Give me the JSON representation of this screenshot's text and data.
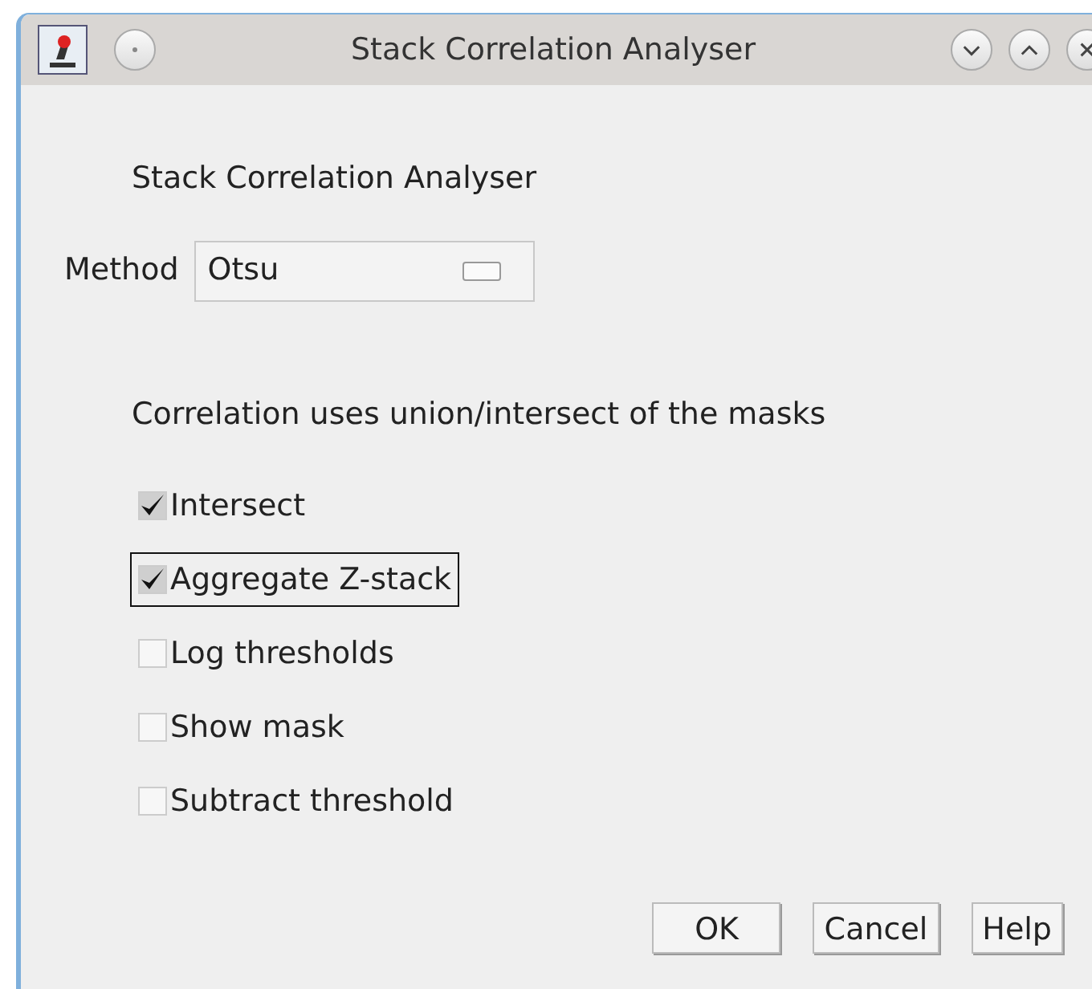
{
  "window": {
    "title": "Stack Correlation Analyser"
  },
  "heading": "Stack Correlation Analyser",
  "method": {
    "label": "Method",
    "value": "Otsu"
  },
  "note": "Correlation uses union/intersect of the masks",
  "options": [
    {
      "label": "Intersect",
      "checked": true,
      "focused": false
    },
    {
      "label": "Aggregate Z-stack",
      "checked": true,
      "focused": true
    },
    {
      "label": "Log thresholds",
      "checked": false,
      "focused": false
    },
    {
      "label": "Show mask",
      "checked": false,
      "focused": false
    },
    {
      "label": "Subtract threshold",
      "checked": false,
      "focused": false
    }
  ],
  "buttons": [
    "OK",
    "Cancel",
    "Help"
  ]
}
